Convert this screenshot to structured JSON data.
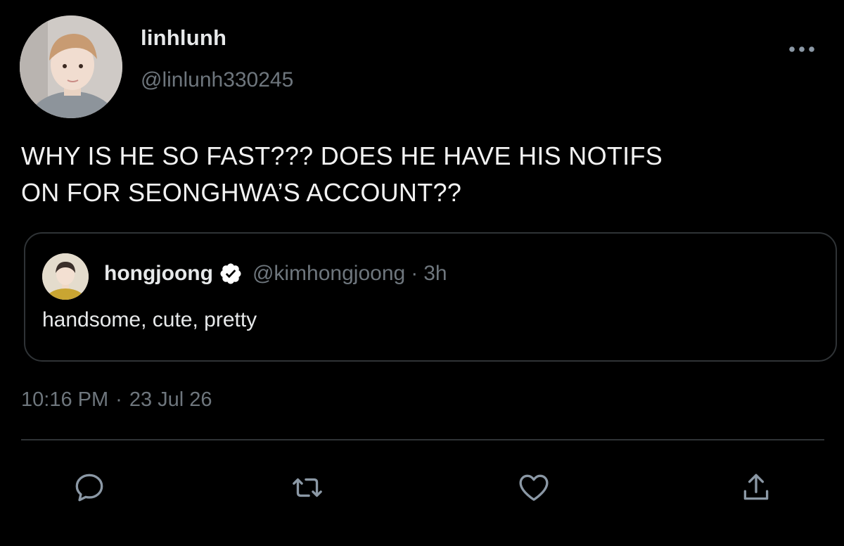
{
  "author": {
    "display_name": "linhlunh",
    "handle": "@linlunh330245",
    "avatar_icon": "profile-photo"
  },
  "more_icon": "more-horizontal-icon",
  "tweet": {
    "text": "WHY IS HE SO FAST??? DOES HE HAVE HIS NOTIFS\nON FOR SEONGHWA’S ACCOUNT??"
  },
  "quoted_tweet": {
    "display_name": "hongjoong",
    "verified": true,
    "handle": "@kimhongjoong",
    "separator": "·",
    "time": "3h",
    "text": "handsome, cute, pretty",
    "avatar_icon": "profile-photo"
  },
  "timestamp": {
    "time": "10:16 PM",
    "separator": "·",
    "date": "23 Jul 26"
  },
  "actions": {
    "reply_icon": "reply-icon",
    "retweet_icon": "retweet-icon",
    "like_icon": "heart-icon",
    "share_icon": "share-icon"
  },
  "colors": {
    "background": "#000000",
    "primary_text": "#e7e9ea",
    "secondary_text": "#6e767d",
    "border": "#2f3336",
    "icon": "#8b98a5"
  }
}
